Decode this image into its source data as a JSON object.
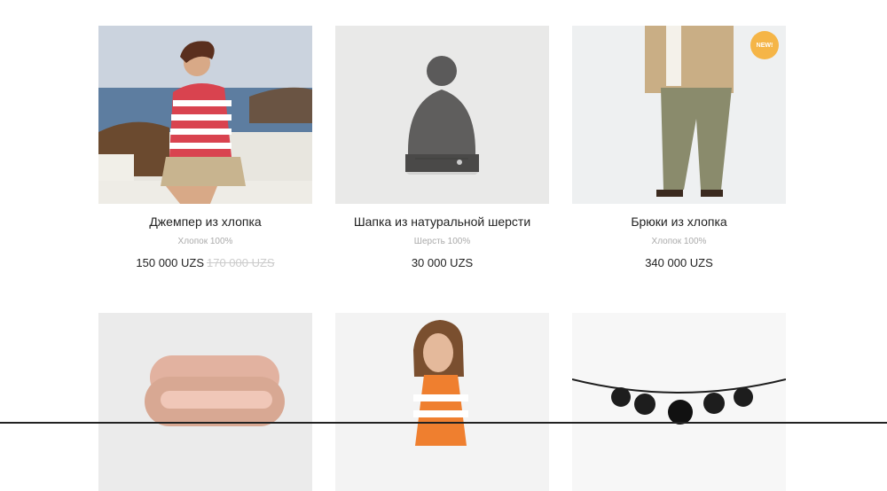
{
  "products": [
    {
      "title": "Джемпер из хлопка",
      "subtitle": "Хлопок 100%",
      "price": "150 000 UZS",
      "old_price": "170 000 UZS"
    },
    {
      "title": "Шапка из натуральной шерсти",
      "subtitle": "Шерсть 100%",
      "price": "30 000 UZS"
    },
    {
      "title": "Брюки из хлопка",
      "subtitle": "Хлопок 100%",
      "price": "340 000 UZS",
      "badge": "NEW!"
    },
    {},
    {},
    {}
  ],
  "colors": {
    "badge": "#f5b547",
    "accent_text": "#222222",
    "muted": "#aaaaaa"
  }
}
